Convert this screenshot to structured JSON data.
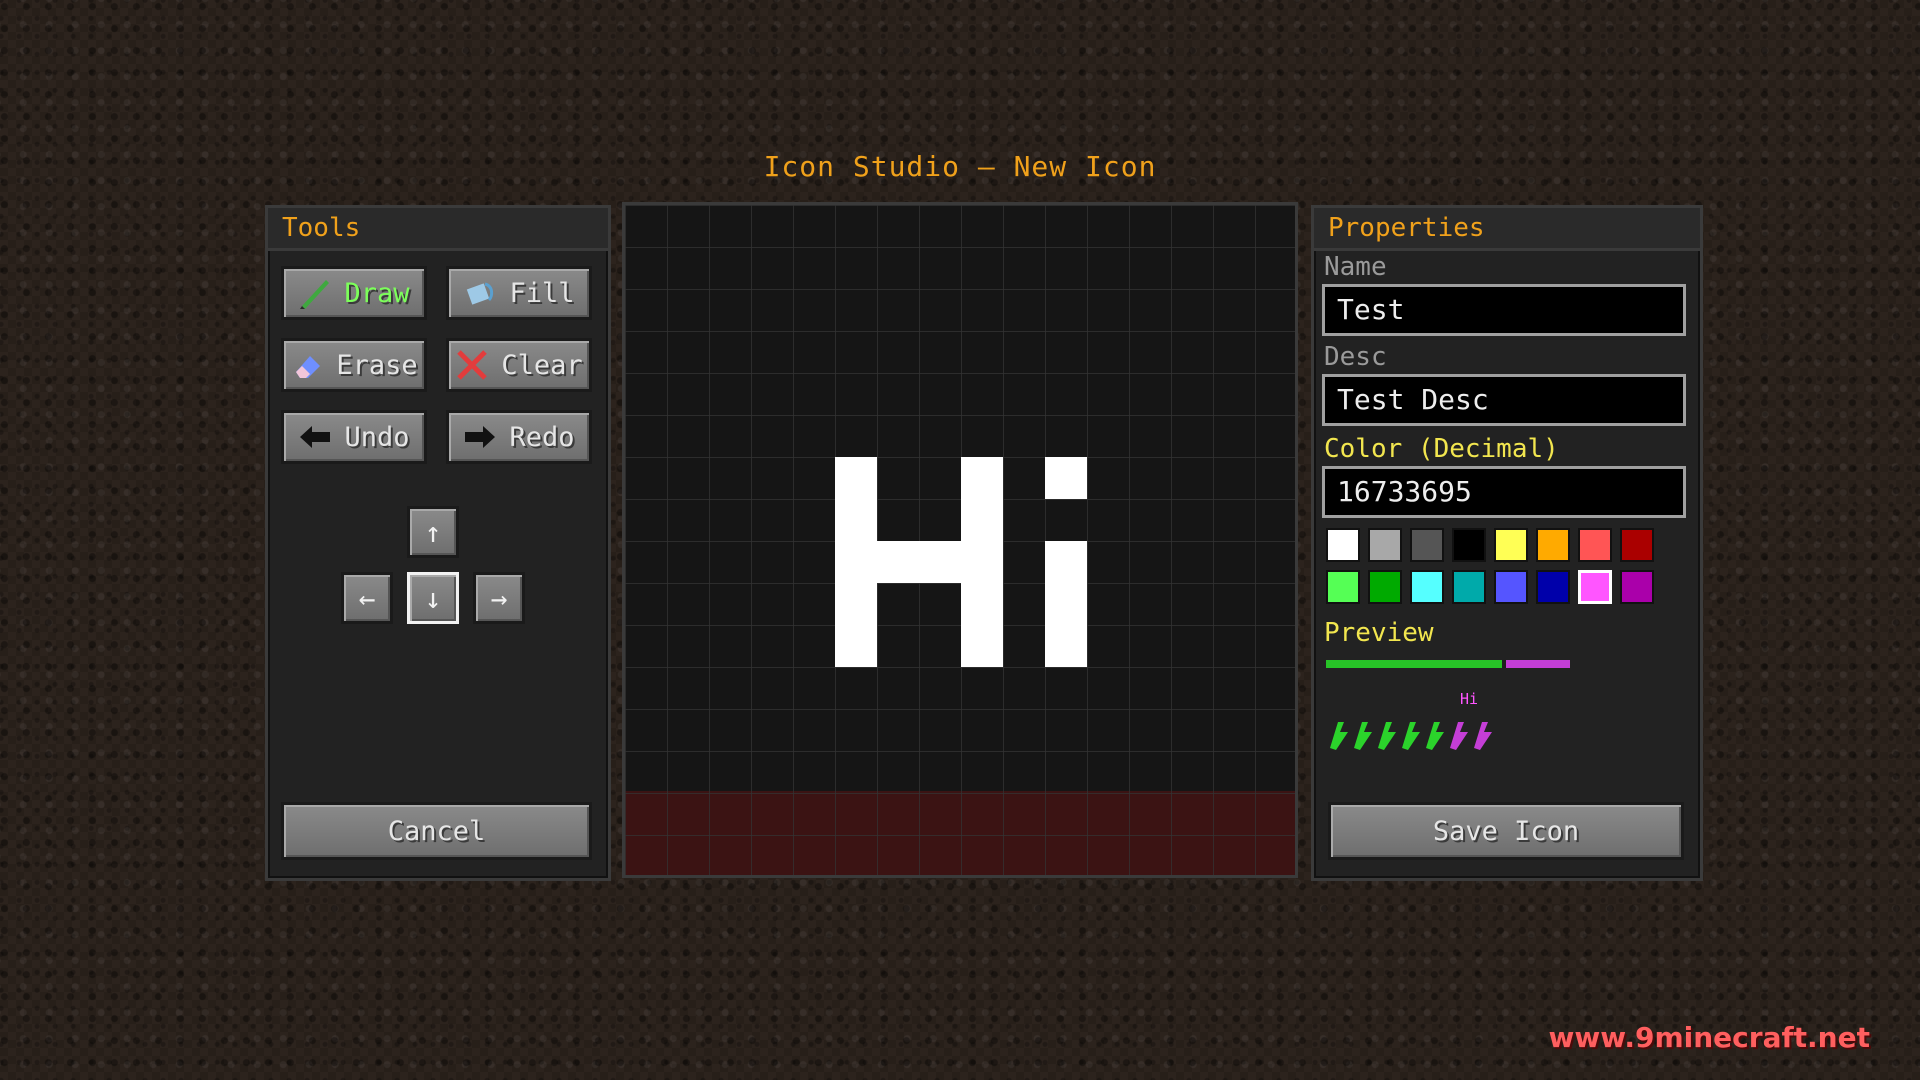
{
  "window": {
    "title": "Icon Studio — New Icon"
  },
  "tools": {
    "header": "Tools",
    "buttons": {
      "draw": "Draw",
      "fill": "Fill",
      "erase": "Erase",
      "clear": "Clear",
      "undo": "Undo",
      "redo": "Redo",
      "cancel": "Cancel"
    },
    "arrows": {
      "up": "↑",
      "left": "←",
      "down": "↓",
      "right": "→"
    },
    "selected_arrow": "down"
  },
  "canvas": {
    "text": "Hi",
    "grid": "on"
  },
  "properties": {
    "header": "Properties",
    "name_label": "Name",
    "name_value": "Test",
    "desc_label": "Desc",
    "desc_value": "Test Desc",
    "color_label": "Color (Decimal)",
    "color_value": "16733695",
    "palette": [
      "#ffffff",
      "#a8a8a8",
      "#555555",
      "#000000",
      "#ffff55",
      "#ffaa00",
      "#ff5555",
      "#aa0000",
      "#55ff55",
      "#00aa00",
      "#55ffff",
      "#00aaaa",
      "#5555ff",
      "#0000aa",
      "#ff55ff",
      "#aa00aa"
    ],
    "selected_color": "#ff55ff",
    "preview_label": "Preview",
    "preview_hi": "Hi",
    "save_button": "Save Icon"
  },
  "watermark": "www.9minecraft.net"
}
